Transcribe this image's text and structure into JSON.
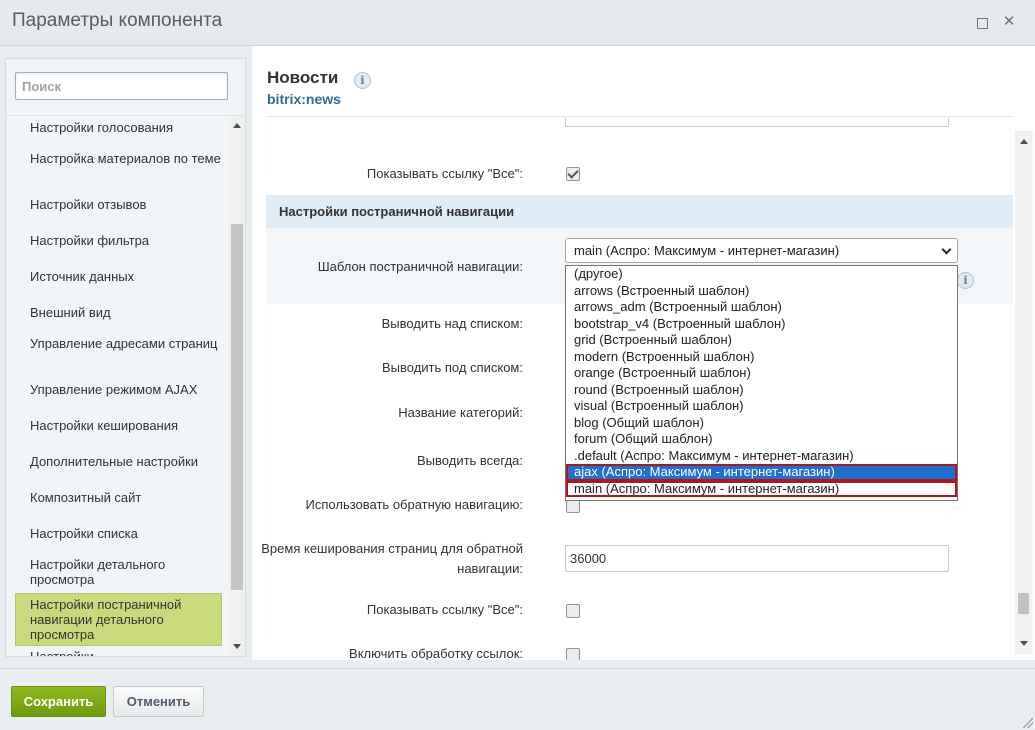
{
  "window": {
    "title": "Параметры компонента"
  },
  "sidebar": {
    "search_placeholder": "Поиск",
    "items": [
      {
        "label": "Настройки голосования"
      },
      {
        "label": "Настройка материалов по теме"
      },
      {
        "label": "Настройки отзывов"
      },
      {
        "label": "Настройки фильтра"
      },
      {
        "label": "Источник данных"
      },
      {
        "label": "Внешний вид"
      },
      {
        "label": "Управление адресами страниц"
      },
      {
        "label": "Управление режимом AJAX"
      },
      {
        "label": "Настройки кеширования"
      },
      {
        "label": "Дополнительные настройки"
      },
      {
        "label": "Композитный сайт"
      },
      {
        "label": "Настройки списка"
      },
      {
        "label": "Настройки детального просмотра"
      },
      {
        "label": "Настройки постраничной навигации детального просмотра",
        "active": true
      },
      {
        "label": "Настройки ..."
      }
    ]
  },
  "component": {
    "name": "Новости",
    "code": "bitrix:news"
  },
  "fields": {
    "show_all_link_1": {
      "label": "Показывать ссылку \"Все\":",
      "checked": true
    },
    "section_title": "Настройки постраничной навигации",
    "pager_template": {
      "label": "Шаблон постраничной навигации:",
      "value": "main (Аспро: Максимум - интернет-магазин)"
    },
    "show_top": {
      "label": "Выводить над списком:"
    },
    "show_bottom": {
      "label": "Выводить под списком:"
    },
    "category_name": {
      "label": "Название категорий:"
    },
    "always_show": {
      "label": "Выводить всегда:"
    },
    "reverse_nav": {
      "label": "Использовать обратную навигацию:",
      "checked": false
    },
    "cache_time": {
      "label_line1": "Время кеширования страниц для обратной",
      "label_line2": "навигации:",
      "value": "36000"
    },
    "show_all_link_2": {
      "label": "Показывать ссылку \"Все\":",
      "checked": false
    },
    "links_processing": {
      "label": "Включить обработку ссылок:"
    }
  },
  "dropdown": {
    "options": [
      "(другое)",
      "arrows (Встроенный шаблон)",
      "arrows_adm (Встроенный шаблон)",
      "bootstrap_v4 (Встроенный шаблон)",
      "grid (Встроенный шаблон)",
      "modern (Встроенный шаблон)",
      "orange (Встроенный шаблон)",
      "round (Встроенный шаблон)",
      "visual (Встроенный шаблон)",
      "blog (Общий шаблон)",
      "forum (Общий шаблон)",
      ".default (Аспро: Максимум - интернет-магазин)",
      "ajax (Аспро: Максимум - интернет-магазин)",
      "main (Аспро: Максимум - интернет-магазин)"
    ],
    "highlighted_index": 12,
    "current_index": 13
  },
  "footer": {
    "save_label": "Сохранить",
    "cancel_label": "Отменить"
  },
  "colors": {
    "accent_green": "#7ba816",
    "active_sidebar": "#c8da7b",
    "section_header": "#e0ecf6",
    "link_blue": "#2c6d94",
    "dropdown_highlight": "#1e70d1",
    "dropdown_outline": "#b2151a"
  }
}
